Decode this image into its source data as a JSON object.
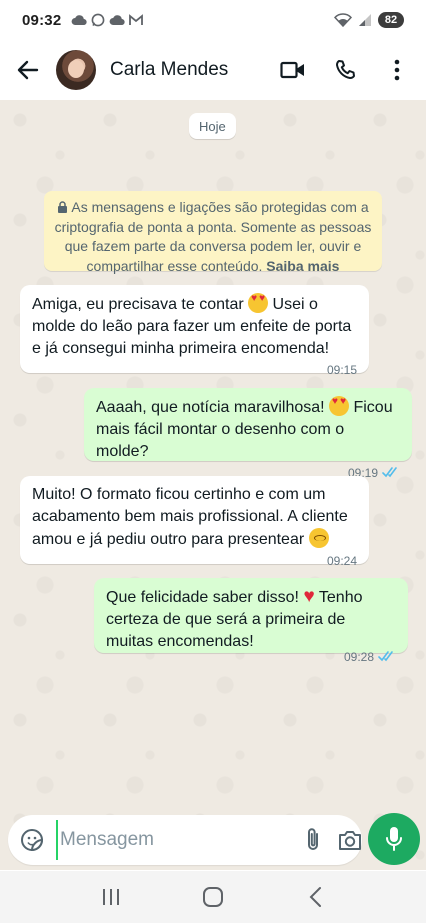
{
  "status_bar": {
    "time": "09:32",
    "battery": "82"
  },
  "header": {
    "contact_name": "Carla Mendes"
  },
  "chat": {
    "date_chip": "Hoje",
    "encryption_notice": {
      "text": "As mensagens e ligações são protegidas com a criptografia de ponta a ponta. Somente as pessoas que fazem parte da conversa podem ler, ouvir e compartilhar esse conteúdo.",
      "link": "Saiba mais"
    },
    "messages": [
      {
        "direction": "incoming",
        "parts": [
          "Amiga, eu precisava te contar ",
          " Usei o molde do leão para fazer um enfeite de porta e já consegui minha primeira encomenda!"
        ],
        "emoji": "heart-eyes-emoji",
        "time": "09:15"
      },
      {
        "direction": "outgoing",
        "parts": [
          "Aaaah, que notícia maravilhosa! ",
          " Ficou mais fácil montar o desenho com o molde?"
        ],
        "emoji": "heart-eyes-emoji",
        "time": "09:19",
        "status": "read"
      },
      {
        "direction": "incoming",
        "parts": [
          "Muito! O formato ficou certinho e com um acabamento bem mais profissional. A cliente amou e já pediu outro para presentear ",
          ""
        ],
        "emoji": "moved-face-emoji",
        "time": "09:24"
      },
      {
        "direction": "outgoing",
        "parts": [
          "Que felicidade saber disso! ",
          " Tenho certeza de que será a primeira de muitas encomendas!"
        ],
        "emoji": "red-heart-emoji",
        "time": "09:28",
        "status": "read"
      }
    ]
  },
  "input": {
    "placeholder": "Mensagem"
  },
  "colors": {
    "chat_background": "#efeae2",
    "outgoing_bubble": "#d9fdd3",
    "incoming_bubble": "#ffffff",
    "encryption_notice": "#fdf4c5",
    "mic_button": "#1daa61",
    "read_ticks": "#53bdeb"
  }
}
